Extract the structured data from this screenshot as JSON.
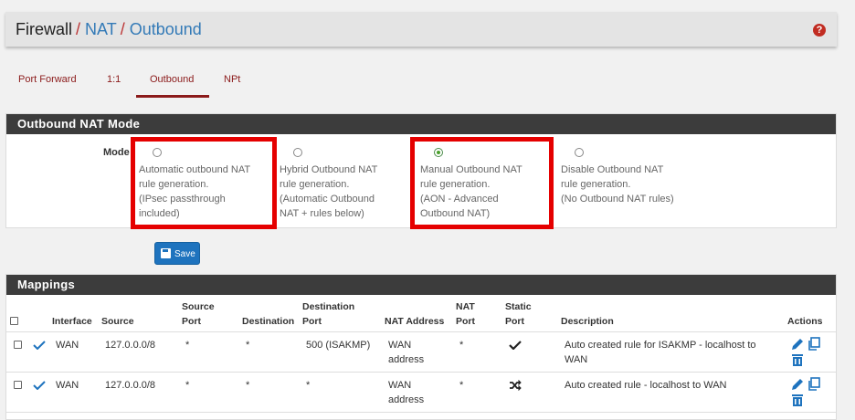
{
  "breadcrumb": {
    "root": "Firewall",
    "nat": "NAT",
    "outbound": "Outbound",
    "sep": "/"
  },
  "help_icon_glyph": "?",
  "tabs": [
    {
      "label": "Port Forward"
    },
    {
      "label": "1:1"
    },
    {
      "label": "Outbound",
      "active": true
    },
    {
      "label": "NPt"
    }
  ],
  "mode_panel": {
    "title": "Outbound NAT Mode",
    "mode_label": "Mode",
    "options": [
      {
        "lines": [
          "Automatic outbound NAT",
          "rule generation.",
          "(IPsec passthrough",
          "included)"
        ],
        "selected": false,
        "highlighted": true
      },
      {
        "lines": [
          "Hybrid Outbound NAT",
          "rule generation.",
          "(Automatic Outbound",
          "NAT + rules below)"
        ],
        "selected": false,
        "highlighted": false
      },
      {
        "lines": [
          "Manual Outbound NAT",
          "rule generation.",
          "(AON - Advanced",
          "Outbound NAT)"
        ],
        "selected": true,
        "highlighted": true
      },
      {
        "lines": [
          "Disable Outbound NAT",
          "rule generation.",
          "(No Outbound NAT rules)"
        ],
        "selected": false,
        "highlighted": false
      }
    ],
    "save_label": "Save"
  },
  "mappings": {
    "title": "Mappings",
    "headers": {
      "interface": "Interface",
      "source": "Source",
      "source_port": [
        "Source",
        "Port"
      ],
      "destination": "Destination",
      "destination_port": [
        "Destination",
        "Port"
      ],
      "nat_address": "NAT Address",
      "nat_port": [
        "NAT",
        "Port"
      ],
      "static_port": [
        "Static",
        "Port"
      ],
      "description": "Description",
      "actions": "Actions"
    },
    "rows": [
      {
        "interface": "WAN",
        "source": "127.0.0.0/8",
        "source_port": "*",
        "destination": "*",
        "destination_port": "500 (ISAKMP)",
        "nat_address": [
          "WAN",
          "address"
        ],
        "nat_port": "*",
        "static_port": "check",
        "description": [
          "Auto created rule for ISAKMP - localhost to",
          "WAN"
        ]
      },
      {
        "interface": "WAN",
        "source": "127.0.0.0/8",
        "source_port": "*",
        "destination": "*",
        "destination_port": "*",
        "nat_address": [
          "WAN",
          "address"
        ],
        "nat_port": "*",
        "static_port": "random",
        "description": [
          "Auto created rule - localhost to WAN"
        ]
      }
    ]
  },
  "colors": {
    "accent": "#8b1a1a",
    "link": "#337ab7",
    "highlight": "#e50000",
    "panel_header": "#3c3c3c",
    "button": "#1e73be"
  }
}
